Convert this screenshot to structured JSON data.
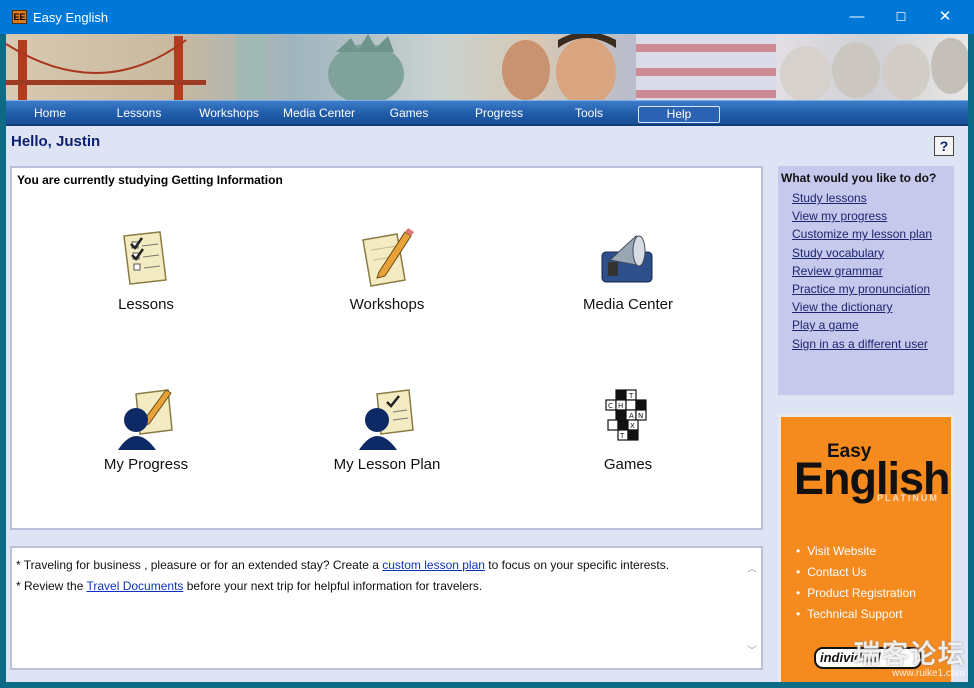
{
  "window": {
    "title": "Easy English",
    "app_icon_text": "EE",
    "minimize_glyph": "—",
    "maximize_glyph": "☐",
    "close_glyph": "✕"
  },
  "nav": {
    "items": [
      {
        "label": "Home"
      },
      {
        "label": "Lessons"
      },
      {
        "label": "Workshops"
      },
      {
        "label": "Media Center"
      },
      {
        "label": "Games"
      },
      {
        "label": "Progress"
      },
      {
        "label": "Tools"
      },
      {
        "label": "Help"
      }
    ],
    "active": "Help"
  },
  "main": {
    "greeting": "Hello, Justin",
    "help_glyph": "?",
    "studying": "You are currently studying Getting Information",
    "tiles": [
      {
        "label": "Lessons",
        "icon": "checklist-icon"
      },
      {
        "label": "Workshops",
        "icon": "notepad-pencil-icon"
      },
      {
        "label": "Media Center",
        "icon": "megaphone-icon"
      },
      {
        "label": "My Progress",
        "icon": "person-notepad-icon"
      },
      {
        "label": "My Lesson Plan",
        "icon": "person-checklist-icon"
      },
      {
        "label": "Games",
        "icon": "crossword-icon"
      }
    ],
    "tips": {
      "line1_a": "* Traveling for business , pleasure or for an extended stay? Create a ",
      "line1_link": "custom lesson plan",
      "line1_b": " to focus on your specific interests.",
      "line2_a": "* Review the ",
      "line2_link": "Travel Documents",
      "line2_b": " before your next trip for helpful information for travelers.",
      "scroll_up": "︿",
      "scroll_down": "﹀"
    }
  },
  "sidebar": {
    "heading": "What would you like to do?",
    "links": [
      "Study lessons",
      "View my progress",
      "Customize my lesson plan",
      "Study vocabulary",
      "Review grammar",
      "Practice my pronunciation",
      "View the dictionary",
      "Play a game",
      "Sign in as a different user"
    ]
  },
  "promo": {
    "easy": "Easy",
    "english": "English",
    "platinum": "PLATINUM",
    "links": [
      "Visit Website",
      "Contact Us",
      "Product Registration",
      "Technical Support"
    ],
    "logo_text": "individual"
  },
  "watermark": {
    "line1": "瑞客论坛",
    "line2": "www.ruike1.com"
  },
  "colors": {
    "nav": "#1f5aa8",
    "content_bg": "#dfe4f5",
    "promo_bg": "#f58a1f",
    "todo_bg": "#c6c9ec",
    "titlebar": "#0078d7"
  }
}
